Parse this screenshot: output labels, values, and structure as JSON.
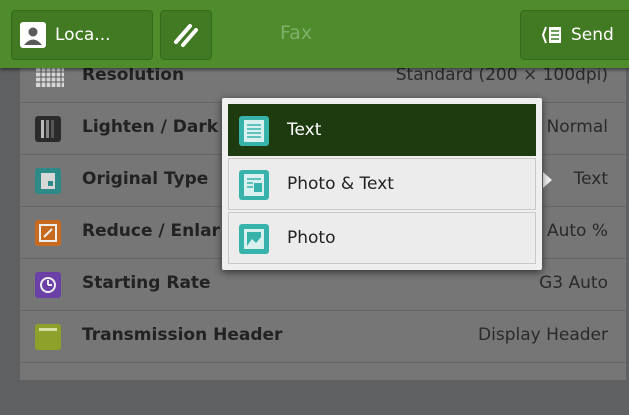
{
  "header": {
    "login_label": "Loca...",
    "title": "Fax",
    "send_label": "Send"
  },
  "settings": [
    {
      "label": "Resolution",
      "value": "Standard (200 × 100dpi)",
      "icon": "grid-icon"
    },
    {
      "label": "Lighten / Dark",
      "value": "Normal",
      "icon": "contrast-icon"
    },
    {
      "label": "Original Type",
      "value": "Text",
      "icon": "document-type-icon"
    },
    {
      "label": "Reduce / Enlar",
      "value": "Auto %",
      "icon": "resize-icon"
    },
    {
      "label": "Starting Rate",
      "value": "G3 Auto",
      "icon": "rate-icon"
    },
    {
      "label": "Transmission Header",
      "value": "Display Header",
      "icon": "header-icon"
    }
  ],
  "popup": {
    "options": [
      {
        "label": "Text",
        "selected": true
      },
      {
        "label": "Photo & Text",
        "selected": false
      },
      {
        "label": "Photo",
        "selected": false
      }
    ]
  },
  "colors": {
    "header": "#4e8c2c",
    "selected_option": "#1e3b10",
    "teal_icon": "#37b3ac"
  }
}
